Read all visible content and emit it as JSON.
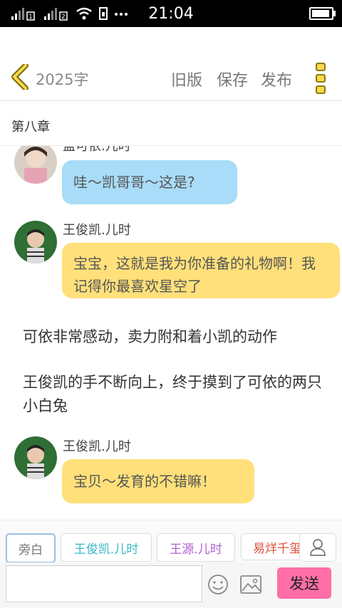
{
  "status": {
    "time": "21:04"
  },
  "header": {
    "word_count": "2025字",
    "old_version": "旧版",
    "save": "保存",
    "publish": "发布"
  },
  "chapter_title": "第八章",
  "messages": [
    {
      "sender": "盖可依.儿时",
      "text": "哇～凯哥哥～这是?",
      "bubble_color": "#a8dcf8"
    },
    {
      "sender": "王俊凯.儿时",
      "text": "宝宝，这就是我为你准备的礼物啊！我记得你最喜欢星空了",
      "bubble_color": "#ffe07a"
    },
    {
      "sender": "王俊凯.儿时",
      "text": "宝贝～发育的不错嘛！",
      "bubble_color": "#ffe07a"
    }
  ],
  "narrations": [
    "可依非常感动，卖力附和着小凯的动作",
    "王俊凯的手不断向上，终于摸到了可依的两只小白兔"
  ],
  "roles": [
    {
      "label": "旁白",
      "color": "#777777"
    },
    {
      "label": "王俊凯.儿时",
      "color": "#3ab8c8"
    },
    {
      "label": "王源.儿时",
      "color": "#b05fd0"
    },
    {
      "label": "易烊千玺",
      "color": "#e0503c"
    }
  ],
  "input": {
    "send_label": "发送"
  },
  "icons": {
    "back": "chevron-left-icon",
    "more": "more-vertical-icon",
    "person": "person-icon",
    "emoji": "smile-icon",
    "image": "image-icon"
  },
  "colors": {
    "accent_yellow": "#f7d84a",
    "send_pink": "#ff6ea6"
  }
}
